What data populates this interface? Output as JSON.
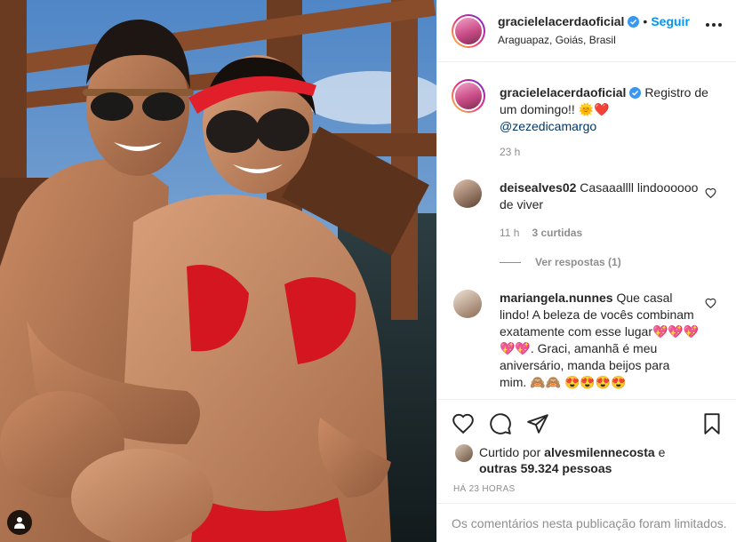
{
  "post": {
    "photo_alt": "",
    "photo_tag_icon": "person-icon"
  },
  "header": {
    "username": "gracielelacerdaoficial",
    "verified_icon": "verified-badge-icon",
    "separator": "•",
    "follow_label": "Seguir",
    "location": "Araguapaz, Goiás, Brasil",
    "more_icon": "more-options-icon"
  },
  "caption": {
    "username": "gracielelacerdaoficial",
    "text": "Registro de um domingo!! 🌞❤️",
    "mention": "@zezedicamargo",
    "time": "23 h"
  },
  "comments": [
    {
      "username": "deisealves02",
      "text": "Casaaallll lindoooooo de viver",
      "time": "11 h",
      "likes": "3 curtidas",
      "replies": "Ver respostas (1)"
    },
    {
      "username": "mariangela.nunnes",
      "text": "Que casal lindo! A beleza de vocês combinam exatamente com esse lugar💖💖💖💖💖. Graci, amanhã é meu aniversário, manda beijos para mim. 🙈🙈 😍😍😍😍"
    }
  ],
  "actions": {
    "like_icon": "heart-icon",
    "comment_icon": "comment-icon",
    "share_icon": "share-icon",
    "save_icon": "bookmark-icon",
    "liked_prefix": "Curtido por",
    "liked_user": "alvesmilennecosta",
    "liked_and": "e",
    "liked_others": "outras 59.324 pessoas",
    "post_time": "HÁ 23 HORAS",
    "comments_limited": "Os comentários nesta publicação foram limitados."
  },
  "colors": {
    "accent": "#0095f6",
    "text": "#262626",
    "muted": "#8e8e8e",
    "border": "#efefef"
  }
}
